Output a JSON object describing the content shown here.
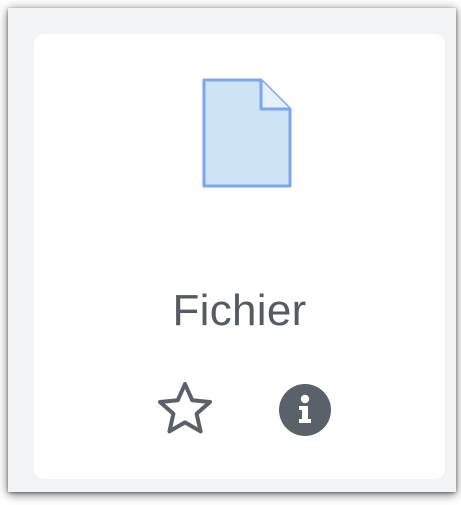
{
  "activity": {
    "name": "Fichier",
    "icon": "file-icon"
  },
  "actions": {
    "star_icon": "star-outline-icon",
    "info_icon": "info-circle-icon"
  },
  "colors": {
    "file_fill": "#cfe3f7",
    "file_stroke": "#7aa7ee",
    "icon_gray": "#5b6168",
    "text": "#545b62"
  }
}
